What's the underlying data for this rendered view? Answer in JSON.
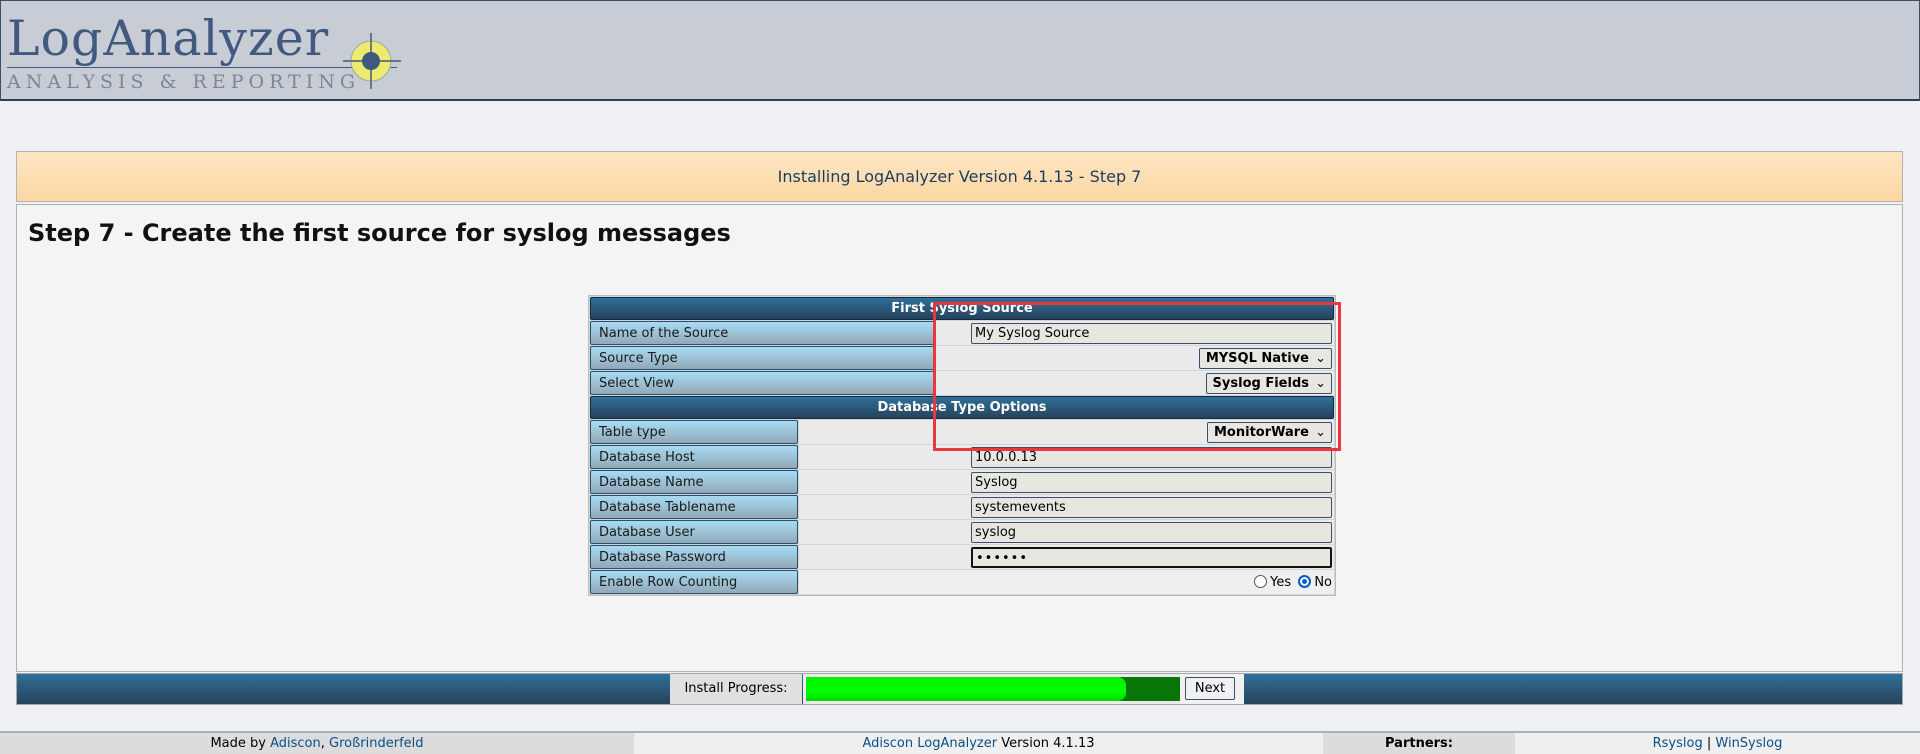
{
  "header": {
    "logo_title": "LogAnalyzer",
    "logo_subtitle": "ANALYSIS & REPORTING"
  },
  "title_bar": "Installing LogAnalyzer Version 4.1.13 - Step 7",
  "heading": "Step 7 - Create the first source for syslog messages",
  "form": {
    "section1_title": "First Syslog Source",
    "name_label": "Name of the Source",
    "name_value": "My Syslog Source",
    "source_type_label": "Source Type",
    "source_type_value": "MYSQL Native",
    "view_label": "Select View",
    "view_value": "Syslog Fields",
    "section2_title": "Database Type Options",
    "table_type_label": "Table type",
    "table_type_value": "MonitorWare",
    "host_label": "Database Host",
    "host_value": "10.0.0.13",
    "dbname_label": "Database Name",
    "dbname_value": "Syslog",
    "tablename_label": "Database Tablename",
    "tablename_value": "systemevents",
    "user_label": "Database User",
    "user_value": "syslog",
    "password_label": "Database Password",
    "password_value": "••••••",
    "rowcount_label": "Enable Row Counting",
    "rowcount_yes": "Yes",
    "rowcount_no": "No",
    "rowcount_selected": "No"
  },
  "progress": {
    "label": "Install Progress:",
    "fraction": 0.83,
    "next_label": "Next"
  },
  "footer": {
    "made_by": "Made by",
    "adiscon": "Adiscon",
    "city": "Großrinderfeld",
    "product_link": "Adiscon LogAnalyzer",
    "version": "Version 4.1.13",
    "partners": "Partners:",
    "rsyslog": "Rsyslog",
    "sep": "|",
    "winsyslog": "WinSyslog"
  },
  "colors": {
    "accent_header": "#27425a",
    "highlight_box": "#e8373f",
    "progress": "#00ff00"
  }
}
